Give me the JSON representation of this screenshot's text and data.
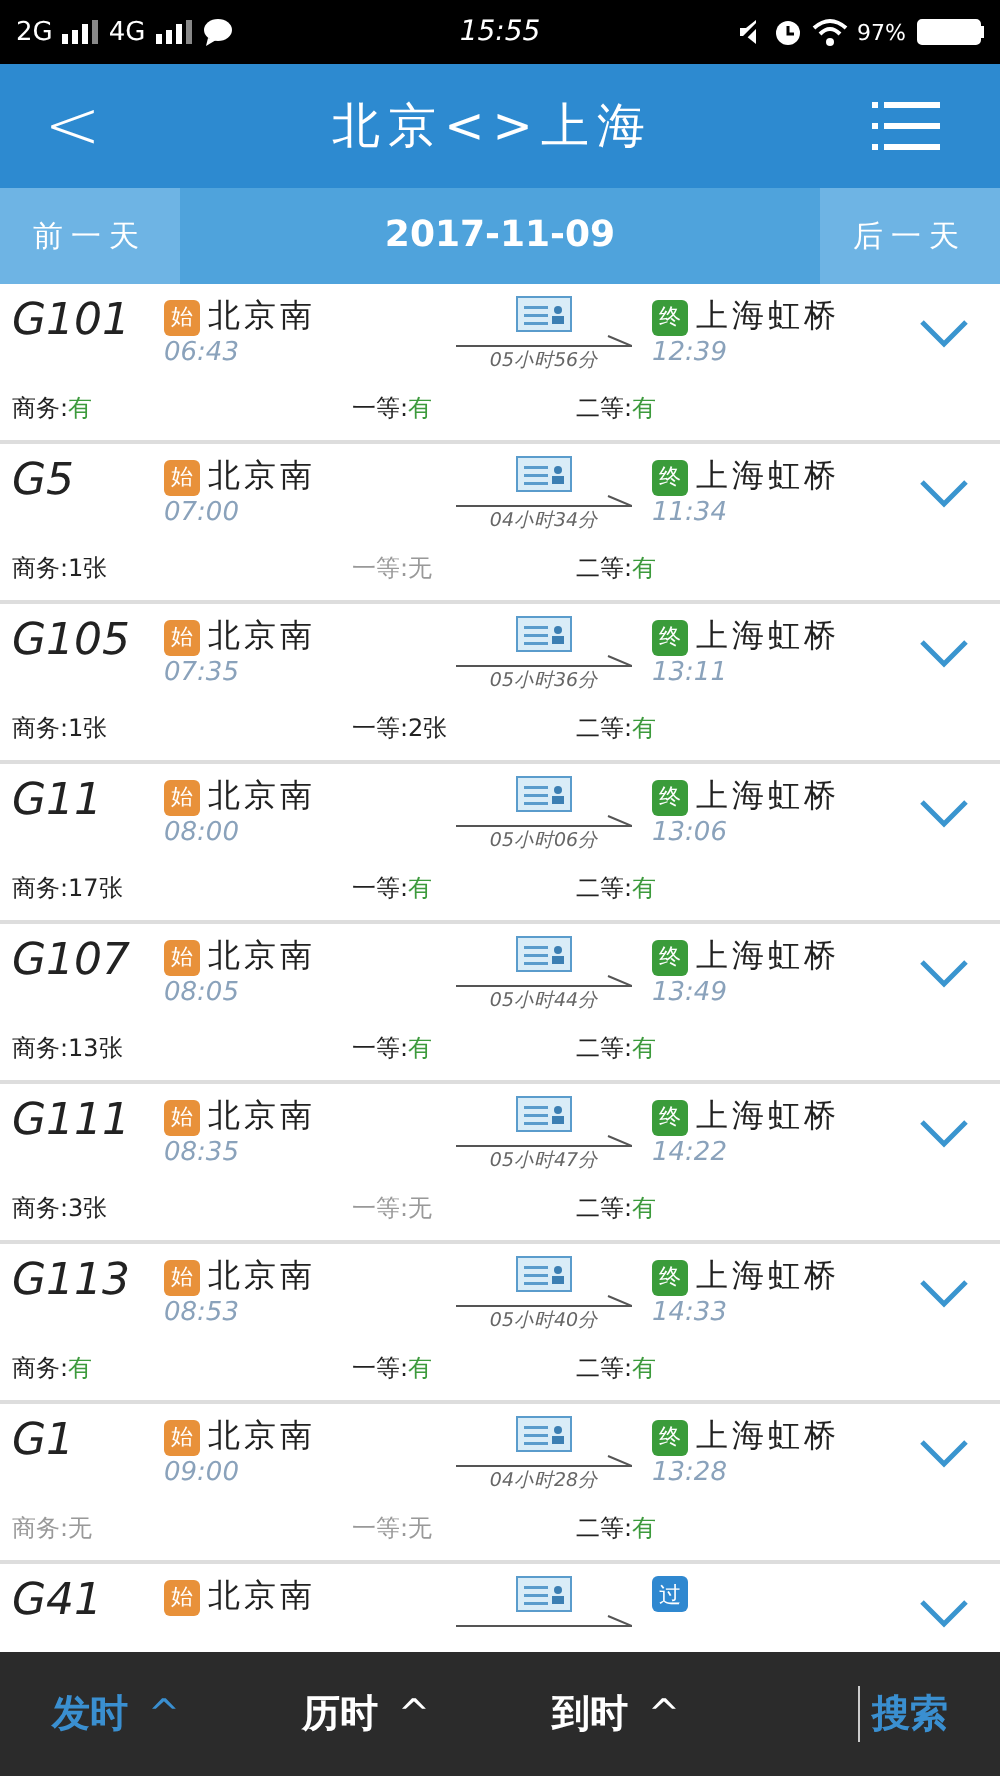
{
  "status_bar": {
    "networks": [
      "2G",
      "4G"
    ],
    "time": "15:55",
    "battery": "97%"
  },
  "header": {
    "back": "<",
    "title": "北京<>上海"
  },
  "date_bar": {
    "prev": "前一天",
    "date": "2017-11-09",
    "next": "后一天"
  },
  "trains": [
    {
      "train": "G101",
      "from_badge": {
        "kind": "start",
        "label": "始"
      },
      "from": "北京南",
      "depart": "06:43",
      "duration": "05小时56分",
      "to_badge": {
        "kind": "end",
        "label": "终"
      },
      "to": "上海虹桥",
      "arrive": "12:39",
      "seats": [
        {
          "label": "商务:",
          "value": "有",
          "kind": "available"
        },
        {
          "label": "一等:",
          "value": "有",
          "kind": "available"
        },
        {
          "label": "二等:",
          "value": "有",
          "kind": "available"
        }
      ]
    },
    {
      "train": "G5",
      "from_badge": {
        "kind": "start",
        "label": "始"
      },
      "from": "北京南",
      "depart": "07:00",
      "duration": "04小时34分",
      "to_badge": {
        "kind": "end",
        "label": "终"
      },
      "to": "上海虹桥",
      "arrive": "11:34",
      "seats": [
        {
          "label": "商务:",
          "value": "1张",
          "kind": "count"
        },
        {
          "label": "一等:",
          "value": "无",
          "kind": "none"
        },
        {
          "label": "二等:",
          "value": "有",
          "kind": "available"
        }
      ]
    },
    {
      "train": "G105",
      "from_badge": {
        "kind": "start",
        "label": "始"
      },
      "from": "北京南",
      "depart": "07:35",
      "duration": "05小时36分",
      "to_badge": {
        "kind": "end",
        "label": "终"
      },
      "to": "上海虹桥",
      "arrive": "13:11",
      "seats": [
        {
          "label": "商务:",
          "value": "1张",
          "kind": "count"
        },
        {
          "label": "一等:",
          "value": "2张",
          "kind": "count"
        },
        {
          "label": "二等:",
          "value": "有",
          "kind": "available"
        }
      ]
    },
    {
      "train": "G11",
      "from_badge": {
        "kind": "start",
        "label": "始"
      },
      "from": "北京南",
      "depart": "08:00",
      "duration": "05小时06分",
      "to_badge": {
        "kind": "end",
        "label": "终"
      },
      "to": "上海虹桥",
      "arrive": "13:06",
      "seats": [
        {
          "label": "商务:",
          "value": "17张",
          "kind": "count"
        },
        {
          "label": "一等:",
          "value": "有",
          "kind": "available"
        },
        {
          "label": "二等:",
          "value": "有",
          "kind": "available"
        }
      ]
    },
    {
      "train": "G107",
      "from_badge": {
        "kind": "start",
        "label": "始"
      },
      "from": "北京南",
      "depart": "08:05",
      "duration": "05小时44分",
      "to_badge": {
        "kind": "end",
        "label": "终"
      },
      "to": "上海虹桥",
      "arrive": "13:49",
      "seats": [
        {
          "label": "商务:",
          "value": "13张",
          "kind": "count"
        },
        {
          "label": "一等:",
          "value": "有",
          "kind": "available"
        },
        {
          "label": "二等:",
          "value": "有",
          "kind": "available"
        }
      ]
    },
    {
      "train": "G111",
      "from_badge": {
        "kind": "start",
        "label": "始"
      },
      "from": "北京南",
      "depart": "08:35",
      "duration": "05小时47分",
      "to_badge": {
        "kind": "end",
        "label": "终"
      },
      "to": "上海虹桥",
      "arrive": "14:22",
      "seats": [
        {
          "label": "商务:",
          "value": "3张",
          "kind": "count"
        },
        {
          "label": "一等:",
          "value": "无",
          "kind": "none"
        },
        {
          "label": "二等:",
          "value": "有",
          "kind": "available"
        }
      ]
    },
    {
      "train": "G113",
      "from_badge": {
        "kind": "start",
        "label": "始"
      },
      "from": "北京南",
      "depart": "08:53",
      "duration": "05小时40分",
      "to_badge": {
        "kind": "end",
        "label": "终"
      },
      "to": "上海虹桥",
      "arrive": "14:33",
      "seats": [
        {
          "label": "商务:",
          "value": "有",
          "kind": "available"
        },
        {
          "label": "一等:",
          "value": "有",
          "kind": "available"
        },
        {
          "label": "二等:",
          "value": "有",
          "kind": "available"
        }
      ]
    },
    {
      "train": "G1",
      "from_badge": {
        "kind": "start",
        "label": "始"
      },
      "from": "北京南",
      "depart": "09:00",
      "duration": "04小时28分",
      "to_badge": {
        "kind": "end",
        "label": "终"
      },
      "to": "上海虹桥",
      "arrive": "13:28",
      "seats": [
        {
          "label": "商务:",
          "value": "无",
          "kind": "none"
        },
        {
          "label": "一等:",
          "value": "无",
          "kind": "none"
        },
        {
          "label": "二等:",
          "value": "有",
          "kind": "available"
        }
      ]
    },
    {
      "train": "G41",
      "from_badge": {
        "kind": "start",
        "label": "始"
      },
      "from": "北京南",
      "to_badge": {
        "kind": "pass",
        "label": "过"
      }
    }
  ],
  "sort_tabs": [
    {
      "label": "发时",
      "arrow": "^",
      "selected": true
    },
    {
      "label": "历时",
      "arrow": "^",
      "selected": false
    },
    {
      "label": "到时",
      "arrow": "^",
      "selected": false
    }
  ],
  "search": "搜索"
}
